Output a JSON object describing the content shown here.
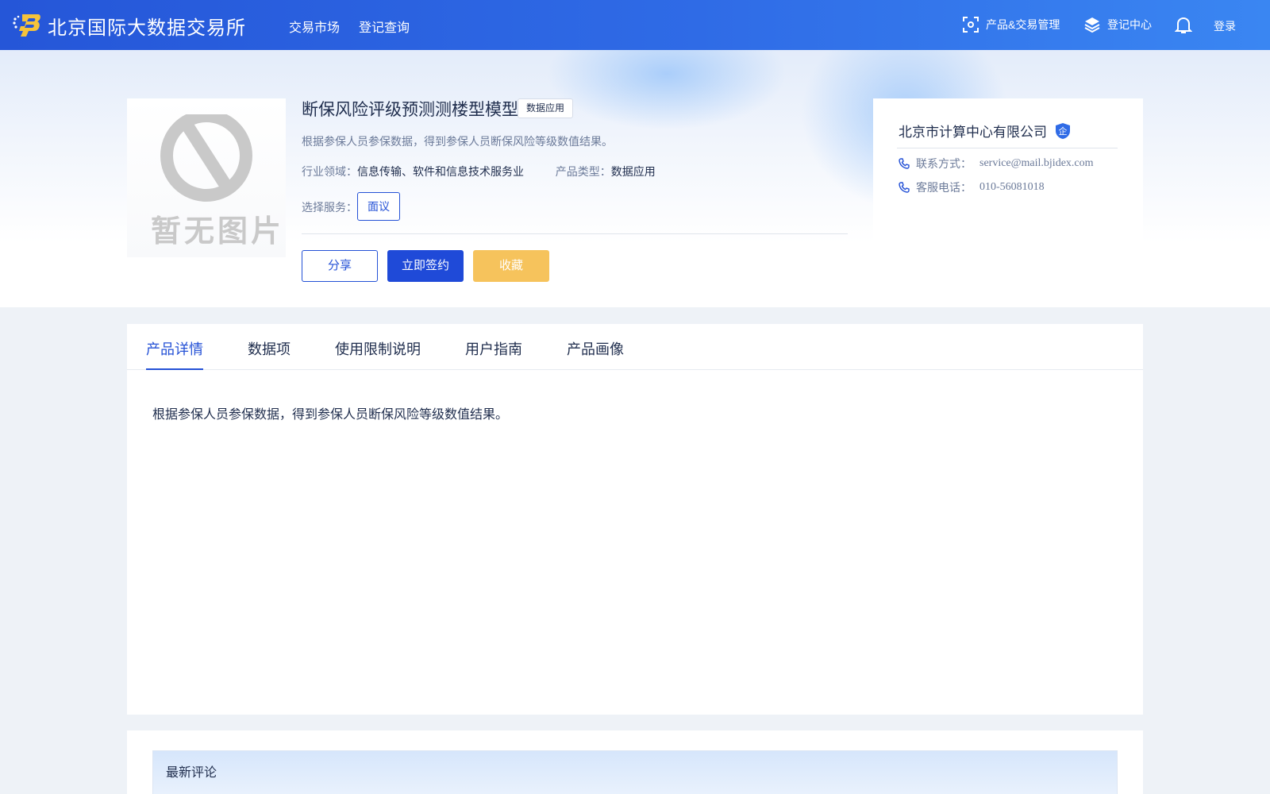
{
  "header": {
    "brand": "北京国际大数据交易所",
    "nav": [
      "交易市场",
      "登记查询"
    ],
    "product_trade_mgmt": "产品&交易管理",
    "registration_center": "登记中心",
    "login": "登录"
  },
  "product": {
    "thumb_placeholder": "暂无图片",
    "title": "断保风险评级预测测楼型模型",
    "tag": "数据应用",
    "description": "根据参保人员参保数据，得到参保人员断保风险等级数值结果。",
    "industry_label": "行业领域：",
    "industry_value": "信息传输、软件和信息技术服务业",
    "type_label": "产品类型：",
    "type_value": "数据应用",
    "service_label": "选择服务：",
    "service_option": "面议",
    "buttons": {
      "share": "分享",
      "sign": "立即签约",
      "favorite": "收藏"
    }
  },
  "company": {
    "name": "北京市计算中心有限公司",
    "badge": "企",
    "contact_label": "联系方式：",
    "contact_value": "service@mail.bjidex.com",
    "phone_label": "客服电话：",
    "phone_value": "010-56081018"
  },
  "tabs": {
    "items": [
      "产品详情",
      "数据项",
      "使用限制说明",
      "用户指南",
      "产品画像"
    ],
    "active": "产品详情",
    "detail_text": "根据参保人员参保数据，得到参保人员断保风险等级数值结果。"
  },
  "comments": {
    "title": "最新评论"
  },
  "colors": {
    "primary": "#2451d6",
    "header_start": "#2556d8",
    "header_end": "#3a86f2",
    "favorite": "#f6c35c"
  }
}
